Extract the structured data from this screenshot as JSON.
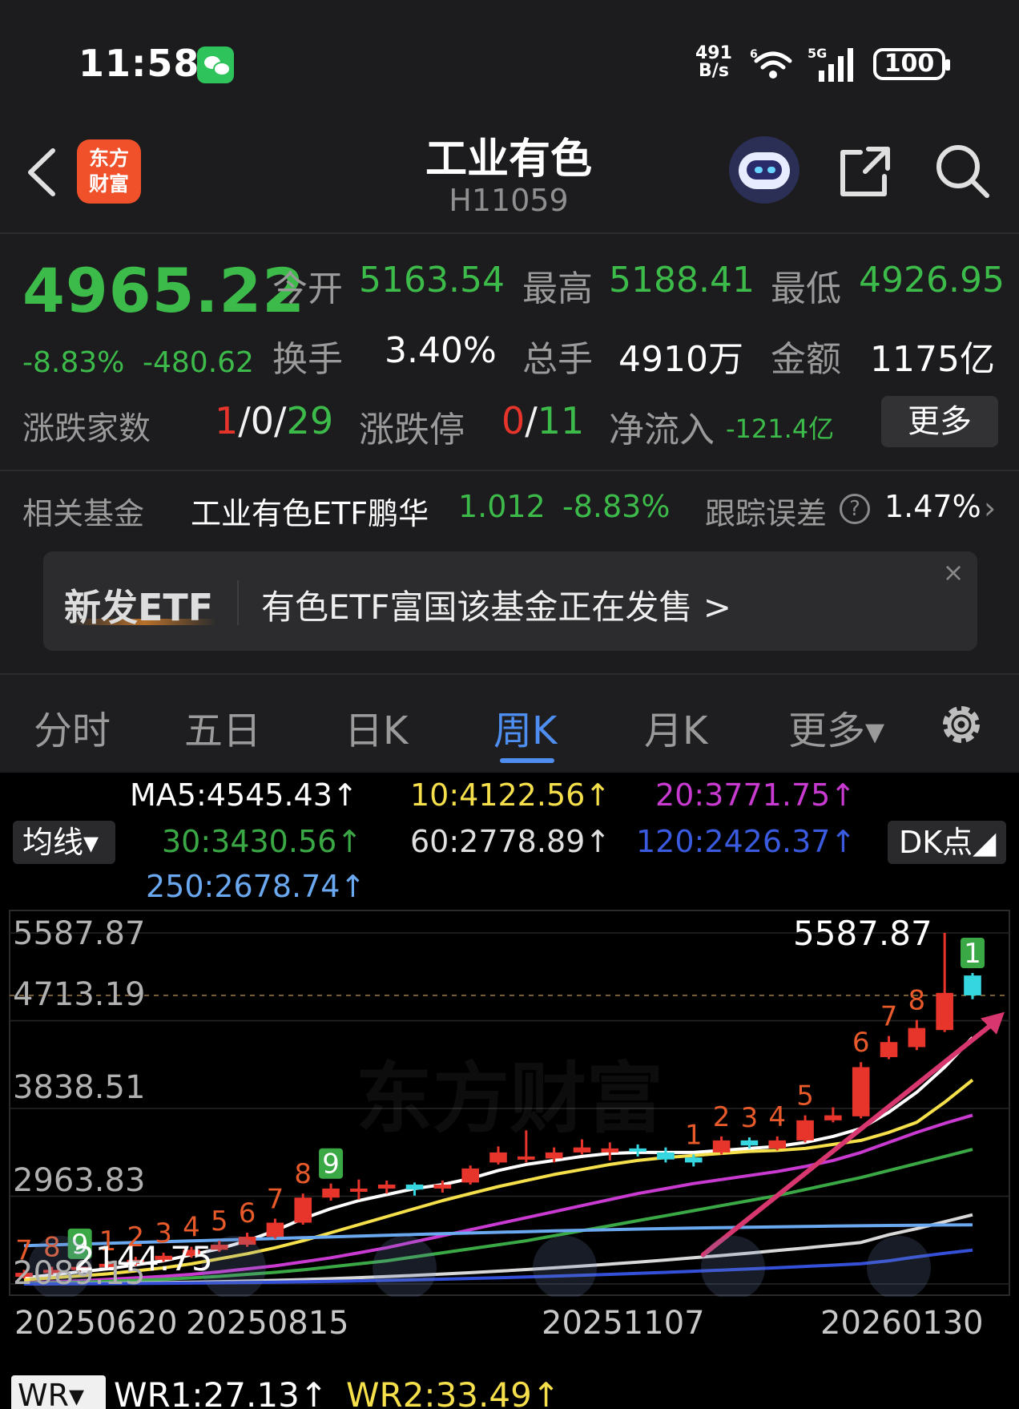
{
  "status_bar": {
    "time": "11:58",
    "net_speed_value": "491",
    "net_speed_unit": "B/s",
    "network_type": "5G",
    "wifi_tag": "6",
    "battery": "100"
  },
  "header": {
    "logo_line1": "东方",
    "logo_line2": "财富",
    "title": "工业有色",
    "code": "H11059"
  },
  "quote": {
    "price": "4965.22",
    "change_pct": "-8.83%",
    "change_abs": "-480.62",
    "open_label": "今开",
    "open": "5163.54",
    "high_label": "最高",
    "high": "5188.41",
    "low_label": "最低",
    "low": "4926.95",
    "turnover_label": "换手",
    "turnover": "3.40%",
    "volume_label": "总手",
    "volume": "4910万",
    "amount_label": "金额",
    "amount": "1175亿",
    "advance_label": "涨跌家数",
    "advance_up": "1",
    "advance_rest": "/0/",
    "advance_down": "29",
    "limit_label": "涨跌停",
    "limit_up": "0",
    "limit_sep": "/",
    "limit_down": "11",
    "flow_label": "净流入",
    "flow": "-121.4亿",
    "more_label": "更多"
  },
  "related_fund": {
    "label": "相关基金",
    "name": "工业有色ETF鹏华",
    "price": "1.012",
    "change": "-8.83%",
    "tracking_label": "跟踪误差",
    "help_glyph": "?",
    "tracking_error": "1.47%",
    "chevron": "›"
  },
  "banner": {
    "tag": "新发ETF",
    "text": "有色ETF富国该基金正在发售  >",
    "close_glyph": "×"
  },
  "tabs": [
    {
      "label": "分时"
    },
    {
      "label": "五日"
    },
    {
      "label": "日K"
    },
    {
      "label": "周K"
    },
    {
      "label": "月K"
    },
    {
      "label": "更多▾"
    }
  ],
  "active_tab": "周K",
  "ma": {
    "select_label": "均线▾",
    "ma5": "MA5:4545.43↑",
    "ma10": "10:4122.56↑",
    "ma20": "20:3771.75↑",
    "ma30": "30:3430.56↑",
    "ma60": "60:2778.89↑",
    "ma120": "120:2426.37↑",
    "ma250": "250:2678.74↑",
    "dk_label": "DK点◢",
    "colors": {
      "ma5": "#ffffff",
      "ma10": "#f5e04b",
      "ma20": "#c83ad0",
      "ma30": "#3aa844",
      "ma60": "#d8d8d8",
      "ma120": "#3450d8",
      "ma250": "#6aa8f0"
    }
  },
  "chart_data": {
    "type": "candlestick",
    "period": "weekly",
    "y_axis_labels": [
      "5587.87",
      "4713.19",
      "3838.51",
      "2963.83",
      "2089.15"
    ],
    "ylim": [
      2089.15,
      5587.87
    ],
    "x_axis_labels": [
      "20250620",
      "20250815",
      "20251107",
      "20260130"
    ],
    "max_marker": "5587.87",
    "min_marker": "2144.75",
    "watermark": "东方财富",
    "candles": [
      {
        "o": 2160,
        "c": 2200,
        "h": 2230,
        "l": 2144.75
      },
      {
        "o": 2200,
        "c": 2230,
        "h": 2260,
        "l": 2180
      },
      {
        "o": 2230,
        "c": 2260,
        "h": 2290,
        "l": 2210
      },
      {
        "o": 2260,
        "c": 2290,
        "h": 2320,
        "l": 2240
      },
      {
        "o": 2290,
        "c": 2330,
        "h": 2360,
        "l": 2270
      },
      {
        "o": 2330,
        "c": 2370,
        "h": 2400,
        "l": 2310
      },
      {
        "o": 2370,
        "c": 2430,
        "h": 2460,
        "l": 2350
      },
      {
        "o": 2430,
        "c": 2480,
        "h": 2520,
        "l": 2410
      },
      {
        "o": 2480,
        "c": 2560,
        "h": 2600,
        "l": 2460
      },
      {
        "o": 2560,
        "c": 2700,
        "h": 2740,
        "l": 2540
      },
      {
        "o": 2700,
        "c": 2950,
        "h": 2990,
        "l": 2680
      },
      {
        "o": 2950,
        "c": 3040,
        "h": 3090,
        "l": 2920
      },
      {
        "o": 3040,
        "c": 3040,
        "h": 3130,
        "l": 2930
      },
      {
        "o": 3040,
        "c": 3080,
        "h": 3120,
        "l": 2990
      },
      {
        "o": 3080,
        "c": 3030,
        "h": 3100,
        "l": 2970
      },
      {
        "o": 3040,
        "c": 3080,
        "h": 3120,
        "l": 3000
      },
      {
        "o": 3100,
        "c": 3240,
        "h": 3270,
        "l": 3080
      },
      {
        "o": 3300,
        "c": 3400,
        "h": 3460,
        "l": 3280
      },
      {
        "o": 3360,
        "c": 3360,
        "h": 3620,
        "l": 3300
      },
      {
        "o": 3340,
        "c": 3400,
        "h": 3450,
        "l": 3300
      },
      {
        "o": 3400,
        "c": 3450,
        "h": 3530,
        "l": 3380
      },
      {
        "o": 3400,
        "c": 3440,
        "h": 3500,
        "l": 3320
      },
      {
        "o": 3440,
        "c": 3410,
        "h": 3480,
        "l": 3360
      },
      {
        "o": 3400,
        "c": 3330,
        "h": 3450,
        "l": 3300
      },
      {
        "o": 3350,
        "c": 3300,
        "h": 3380,
        "l": 3260
      },
      {
        "o": 3400,
        "c": 3520,
        "h": 3560,
        "l": 3380
      },
      {
        "o": 3520,
        "c": 3470,
        "h": 3550,
        "l": 3440
      },
      {
        "o": 3440,
        "c": 3520,
        "h": 3560,
        "l": 3420
      },
      {
        "o": 3520,
        "c": 3720,
        "h": 3770,
        "l": 3500
      },
      {
        "o": 3720,
        "c": 3770,
        "h": 3850,
        "l": 3700
      },
      {
        "o": 3760,
        "c": 4250,
        "h": 4300,
        "l": 3740
      },
      {
        "o": 4350,
        "c": 4500,
        "h": 4560,
        "l": 4330
      },
      {
        "o": 4450,
        "c": 4640,
        "h": 4720,
        "l": 4420
      },
      {
        "o": 4620,
        "c": 4990,
        "h": 5587.87,
        "l": 4600
      },
      {
        "o": 5163.54,
        "c": 4965.22,
        "h": 5188.41,
        "l": 4926.95
      }
    ],
    "td_counts": [
      {
        "i": 0,
        "n": "7",
        "color": "#e85a2a"
      },
      {
        "i": 1,
        "n": "8",
        "color": "#e85a2a"
      },
      {
        "i": 2,
        "n": "9",
        "color": "#3aa844"
      },
      {
        "i": 3,
        "n": "1",
        "color": "#e85a2a"
      },
      {
        "i": 4,
        "n": "2",
        "color": "#e85a2a"
      },
      {
        "i": 5,
        "n": "3",
        "color": "#e85a2a"
      },
      {
        "i": 6,
        "n": "4",
        "color": "#e85a2a"
      },
      {
        "i": 7,
        "n": "5",
        "color": "#e85a2a"
      },
      {
        "i": 8,
        "n": "6",
        "color": "#e85a2a"
      },
      {
        "i": 9,
        "n": "7",
        "color": "#e85a2a"
      },
      {
        "i": 10,
        "n": "8",
        "color": "#e85a2a"
      },
      {
        "i": 11,
        "n": "9",
        "color": "#3aa844"
      },
      {
        "i": 24,
        "n": "1",
        "color": "#e85a2a"
      },
      {
        "i": 25,
        "n": "2",
        "color": "#e85a2a"
      },
      {
        "i": 26,
        "n": "3",
        "color": "#e85a2a"
      },
      {
        "i": 27,
        "n": "4",
        "color": "#e85a2a"
      },
      {
        "i": 28,
        "n": "5",
        "color": "#e85a2a"
      },
      {
        "i": 30,
        "n": "6",
        "color": "#e85a2a"
      },
      {
        "i": 31,
        "n": "7",
        "color": "#e85a2a"
      },
      {
        "i": 32,
        "n": "8",
        "color": "#e85a2a"
      },
      {
        "i": 34,
        "n": "1",
        "color": "#3aa844"
      }
    ],
    "ma_series": [
      {
        "name": "MA5",
        "color": "#ffffff",
        "values": [
          2150,
          2180,
          2210,
          2240,
          2280,
          2320,
          2380,
          2440,
          2520,
          2620,
          2740,
          2840,
          2920,
          2980,
          3040,
          3080,
          3140,
          3220,
          3280,
          3320,
          3360,
          3390,
          3400,
          3400,
          3400,
          3420,
          3440,
          3460,
          3500,
          3560,
          3640,
          3800,
          4000,
          4250,
          4545.43
        ]
      },
      {
        "name": "10",
        "color": "#f5e04b",
        "values": [
          2130,
          2150,
          2170,
          2190,
          2220,
          2250,
          2290,
          2340,
          2390,
          2450,
          2520,
          2600,
          2680,
          2760,
          2840,
          2920,
          2990,
          3060,
          3120,
          3180,
          3230,
          3280,
          3320,
          3350,
          3370,
          3390,
          3410,
          3420,
          3440,
          3480,
          3520,
          3600,
          3700,
          3900,
          4122.56
        ]
      },
      {
        "name": "20",
        "color": "#c83ad0",
        "values": [
          2100,
          2110,
          2120,
          2135,
          2150,
          2165,
          2185,
          2210,
          2240,
          2270,
          2310,
          2350,
          2400,
          2450,
          2510,
          2570,
          2630,
          2690,
          2750,
          2810,
          2870,
          2930,
          2990,
          3040,
          3090,
          3130,
          3170,
          3210,
          3260,
          3320,
          3400,
          3500,
          3600,
          3690,
          3771.75
        ]
      },
      {
        "name": "30",
        "color": "#3aa844",
        "values": [
          2095,
          2100,
          2105,
          2115,
          2125,
          2135,
          2150,
          2165,
          2185,
          2205,
          2230,
          2260,
          2290,
          2320,
          2360,
          2400,
          2440,
          2480,
          2520,
          2570,
          2620,
          2670,
          2720,
          2770,
          2820,
          2870,
          2920,
          2970,
          3030,
          3090,
          3150,
          3220,
          3290,
          3360,
          3430.56
        ]
      },
      {
        "name": "60",
        "color": "#d8d8d8",
        "values": [
          2090,
          2092,
          2094,
          2097,
          2100,
          2103,
          2107,
          2112,
          2118,
          2125,
          2133,
          2142,
          2152,
          2163,
          2175,
          2188,
          2202,
          2217,
          2233,
          2250,
          2268,
          2287,
          2307,
          2328,
          2350,
          2373,
          2397,
          2422,
          2448,
          2475,
          2503,
          2580,
          2640,
          2710,
          2778.89
        ]
      },
      {
        "name": "120",
        "color": "#3450d8",
        "values": [
          2089.15,
          2090,
          2091,
          2092,
          2094,
          2096,
          2098,
          2101,
          2104,
          2107,
          2111,
          2115,
          2120,
          2125,
          2131,
          2137,
          2144,
          2151,
          2159,
          2167,
          2176,
          2185,
          2195,
          2205,
          2216,
          2227,
          2239,
          2251,
          2264,
          2277,
          2291,
          2320,
          2360,
          2395,
          2426.37
        ]
      },
      {
        "name": "250",
        "color": "#6aa8f0",
        "values": [
          2470,
          2478,
          2486,
          2494,
          2502,
          2510,
          2518,
          2526,
          2534,
          2542,
          2550,
          2558,
          2566,
          2574,
          2582,
          2590,
          2597,
          2604,
          2611,
          2618,
          2624,
          2630,
          2636,
          2641,
          2646,
          2651,
          2655,
          2659,
          2663,
          2666,
          2669,
          2672,
          2675,
          2677,
          2678.74
        ]
      }
    ],
    "colors": {
      "up": "#e8352b",
      "down": "#36d6e0",
      "arrow": "#d8366e"
    }
  },
  "indicator": {
    "select_label": "WR▾",
    "wr1": "WR1:27.13↑",
    "wr2": "WR2:33.49↑"
  }
}
